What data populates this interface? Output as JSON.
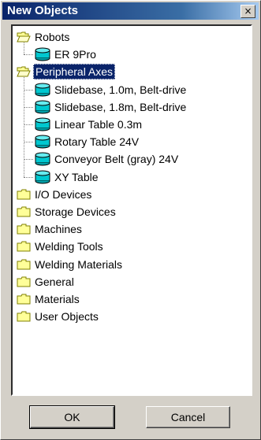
{
  "window": {
    "title": "New Objects",
    "close_glyph": "×"
  },
  "tree": [
    {
      "label": "Robots",
      "type": "folder",
      "expanded": true,
      "children": [
        {
          "label": "ER 9Pro",
          "type": "object"
        }
      ]
    },
    {
      "label": "Peripheral Axes",
      "type": "folder",
      "expanded": true,
      "selected": true,
      "children": [
        {
          "label": "Slidebase, 1.0m, Belt-drive",
          "type": "object"
        },
        {
          "label": "Slidebase, 1.8m, Belt-drive",
          "type": "object"
        },
        {
          "label": "Linear Table 0.3m",
          "type": "object"
        },
        {
          "label": "Rotary Table 24V",
          "type": "object"
        },
        {
          "label": "Conveyor Belt (gray) 24V",
          "type": "object"
        },
        {
          "label": "XY Table",
          "type": "object"
        }
      ]
    },
    {
      "label": "I/O Devices",
      "type": "folder"
    },
    {
      "label": "Storage Devices",
      "type": "folder"
    },
    {
      "label": "Machines",
      "type": "folder"
    },
    {
      "label": "Welding Tools",
      "type": "folder"
    },
    {
      "label": "Welding Materials",
      "type": "folder"
    },
    {
      "label": "General",
      "type": "folder"
    },
    {
      "label": "Materials",
      "type": "folder"
    },
    {
      "label": "User Objects",
      "type": "folder"
    }
  ],
  "buttons": {
    "ok": "OK",
    "cancel": "Cancel"
  },
  "colors": {
    "title_bar": "#0a246a",
    "selection": "#0a246a",
    "folder_yellow": "#ffff99",
    "object_cyan": "#00c8d0"
  }
}
